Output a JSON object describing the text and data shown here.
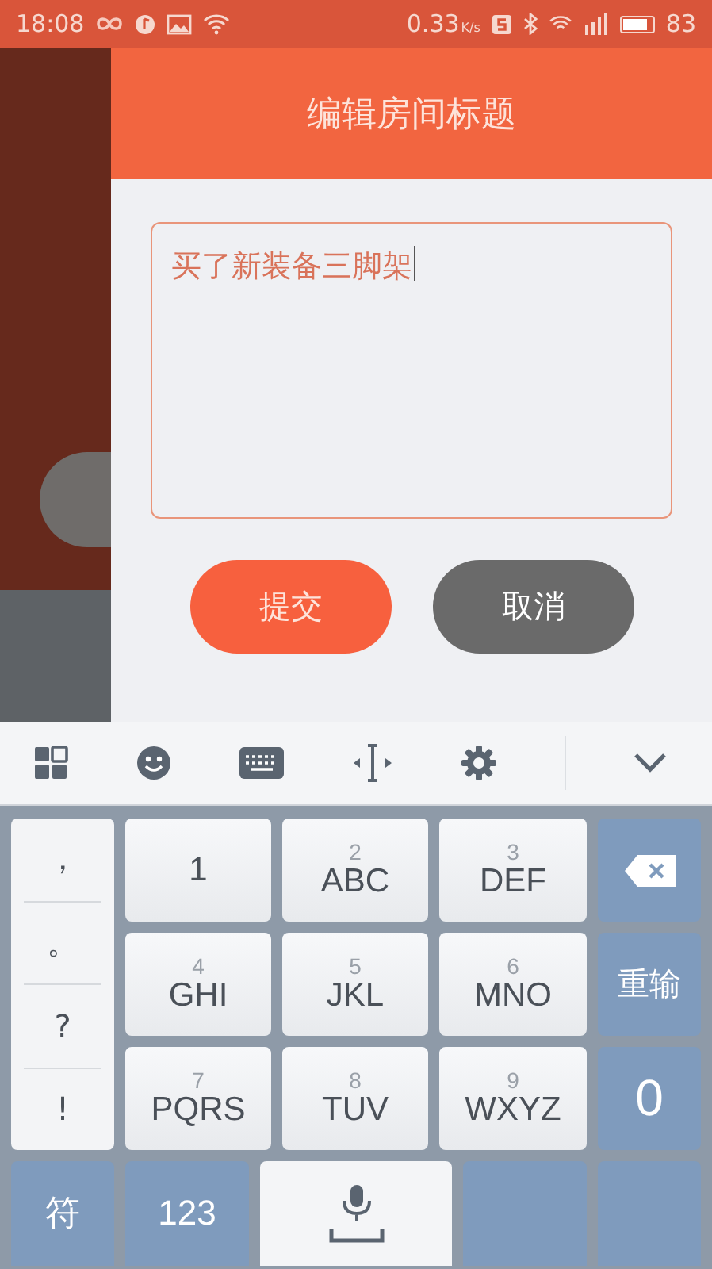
{
  "status_bar": {
    "time": "18:08",
    "speed": "0.33",
    "speed_unit": "K/s",
    "battery": "83"
  },
  "dialog": {
    "title": "编辑房间标题",
    "input_value": "买了新装备三脚架",
    "buttons": [
      {
        "label": "提交",
        "kind": "primary"
      },
      {
        "label": "取消",
        "kind": "secondary"
      }
    ]
  },
  "keyboard": {
    "punctuation": [
      "，",
      "。",
      "?",
      "!"
    ],
    "key_rows": [
      {
        "keys": [
          {
            "letters": "1"
          },
          {
            "digit": "2",
            "letters": "ABC"
          },
          {
            "digit": "3",
            "letters": "DEF"
          }
        ]
      },
      {
        "keys": [
          {
            "digit": "4",
            "letters": "GHI"
          },
          {
            "digit": "5",
            "letters": "JKL"
          },
          {
            "digit": "6",
            "letters": "MNO"
          }
        ]
      },
      {
        "keys": [
          {
            "digit": "7",
            "letters": "PQRS"
          },
          {
            "digit": "8",
            "letters": "TUV"
          },
          {
            "digit": "9",
            "letters": "WXYZ"
          }
        ]
      }
    ],
    "side_keys": [
      {
        "kind": "delete"
      },
      {
        "kind": "text",
        "label": "重输"
      },
      {
        "kind": "text",
        "label": "0"
      }
    ],
    "bottom_keys": [
      {
        "kind": "text",
        "label": "符"
      },
      {
        "kind": "text",
        "label": "123"
      },
      {
        "kind": "mic"
      },
      {
        "kind": "blank"
      },
      {
        "kind": "blank"
      }
    ]
  }
}
